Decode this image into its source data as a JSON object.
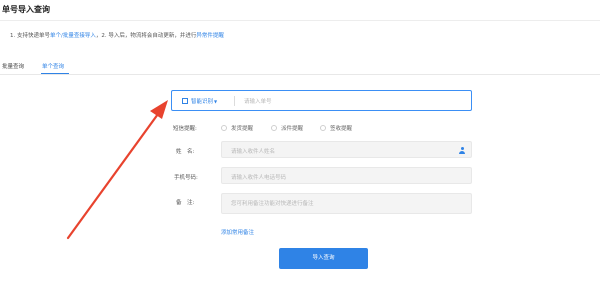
{
  "page": {
    "title": "单号导入查询"
  },
  "tip": {
    "prefix": "1. 支持快递单号",
    "link1": "单个",
    "sep": "/",
    "link2": "批量查接导入",
    "middle": "，2. 导入后，物流将会自动更新，并进行",
    "link3": "异常件提醒"
  },
  "tabs": [
    {
      "label": "批量查询",
      "active": false
    },
    {
      "label": "单个查询",
      "active": true
    }
  ],
  "search": {
    "smart_label": "智能识别",
    "placeholder": "请输入单号"
  },
  "form": {
    "sms": {
      "label": "短信提醒:",
      "options": [
        "发货提醒",
        "派件提醒",
        "签收提醒"
      ]
    },
    "name": {
      "label": "姓　名:",
      "placeholder": "请输入收件人姓名"
    },
    "phone": {
      "label": "手机号码:",
      "placeholder": "请输入收件人电话号码"
    },
    "remark": {
      "label": "备　注:",
      "placeholder": "您可利用备注功能对快递进行备注"
    },
    "add_remark_link": "添加常用备注",
    "submit_label": "导入查询"
  },
  "colors": {
    "accent": "#2f83e6",
    "arrow": "#e8432e"
  },
  "icons": {
    "scan": "scan-icon",
    "dropdown": "caret-down-icon",
    "person": "person-icon",
    "annotation": "red-arrow-icon"
  }
}
